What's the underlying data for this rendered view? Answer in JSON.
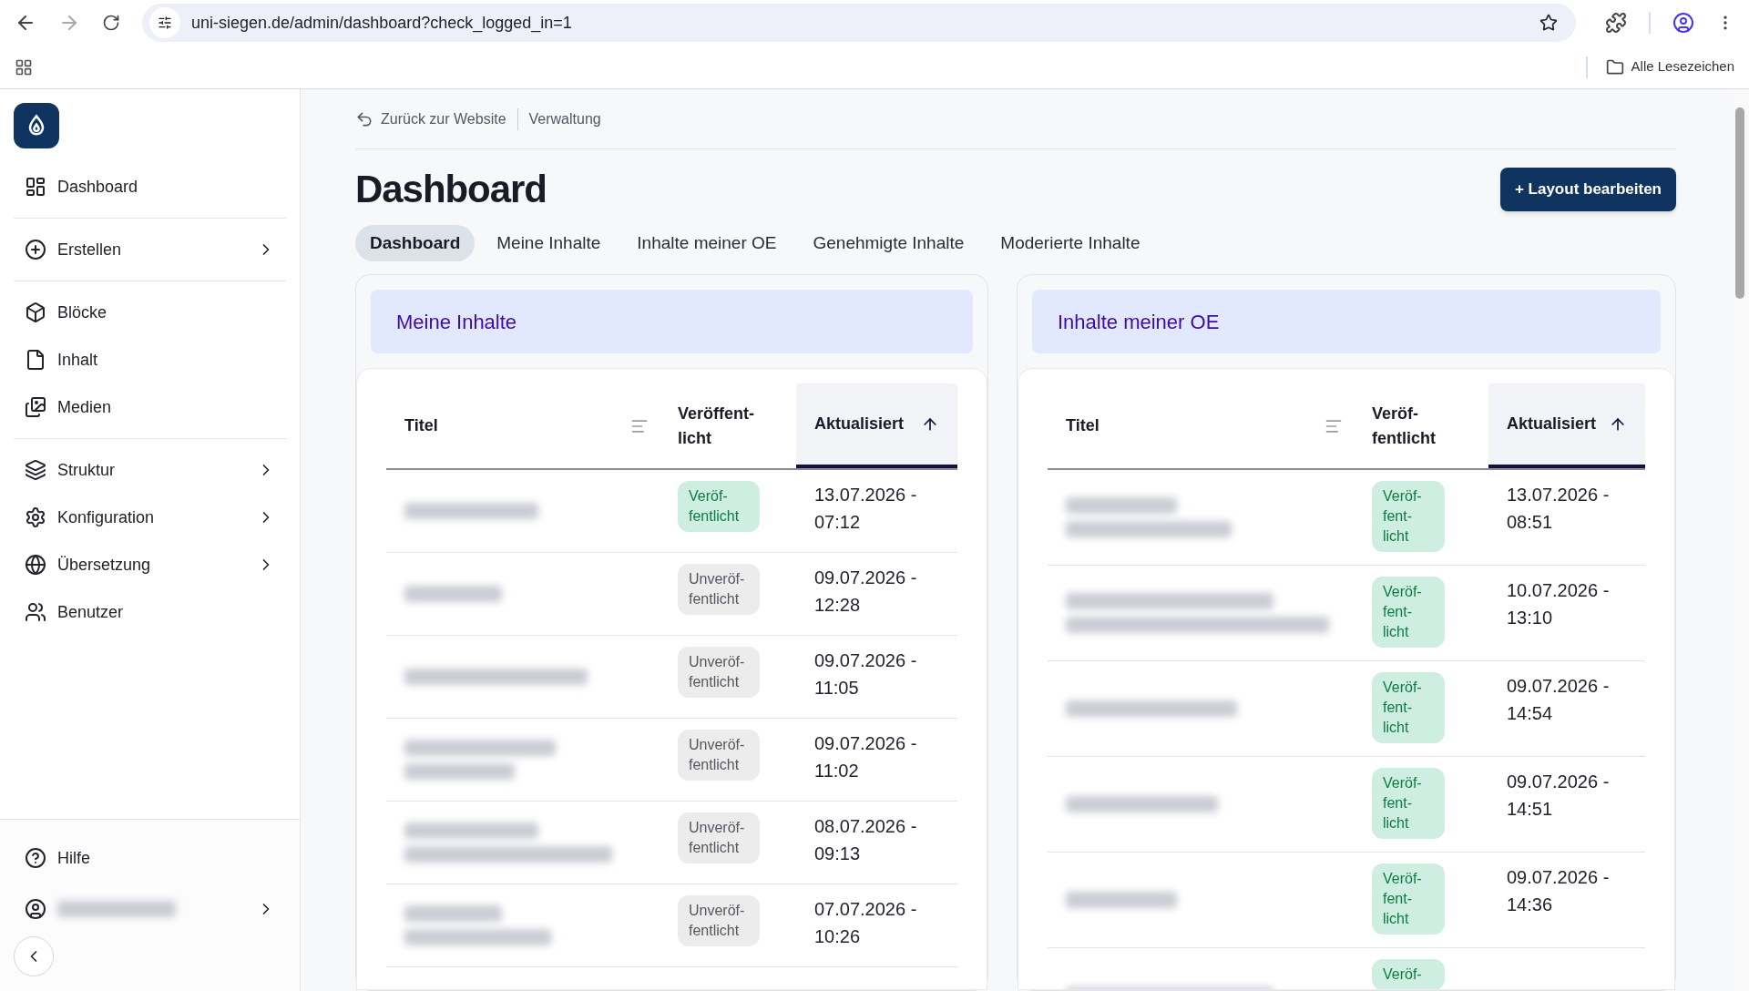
{
  "browser": {
    "url": "uni-siegen.de/admin/dashboard?check_logged_in=1",
    "bookmarks_label": "Alle Lesezeichen"
  },
  "sidebar": {
    "groups": [
      [
        {
          "label": "Dashboard",
          "has_submenu": false
        }
      ],
      [
        {
          "label": "Erstellen",
          "has_submenu": true
        }
      ],
      [
        {
          "label": "Blöcke",
          "has_submenu": false
        },
        {
          "label": "Inhalt",
          "has_submenu": false
        },
        {
          "label": "Medien",
          "has_submenu": false
        }
      ],
      [
        {
          "label": "Struktur",
          "has_submenu": true
        },
        {
          "label": "Konfiguration",
          "has_submenu": true
        },
        {
          "label": "Übersetzung",
          "has_submenu": true
        },
        {
          "label": "Benutzer",
          "has_submenu": false
        }
      ]
    ],
    "help": {
      "label": "Hilfe"
    },
    "user": {
      "kind": "redacted"
    }
  },
  "breadcrumb": [
    {
      "label": "Zurück zur Website",
      "kind": "back"
    },
    {
      "label": "Verwaltung",
      "kind": "plain"
    }
  ],
  "page_title": "Dashboard",
  "primary_button": "+ Layout bearbeiten",
  "tabs": [
    {
      "label": "Dashboard",
      "selected": true
    },
    {
      "label": "Meine Inhalte",
      "selected": false
    },
    {
      "label": "Inhalte meiner OE",
      "selected": false
    },
    {
      "label": "Genehmigte Inhalte",
      "selected": false
    },
    {
      "label": "Moderierte Inhalte",
      "selected": false
    }
  ],
  "panels": [
    {
      "title": "Meine Inhalte",
      "columns": [
        {
          "label": [
            "Titel"
          ],
          "sorted": false,
          "filter": true
        },
        {
          "label": [
            "Veröffent-",
            "licht"
          ],
          "sorted": false,
          "filter": false
        },
        {
          "label": [
            "Aktualisiert"
          ],
          "sorted": true,
          "filter": false
        }
      ],
      "rows": [
        {
          "kind": "redacted-single",
          "published": true,
          "status": [
            "Veröf-",
            "fentlicht"
          ],
          "updated": [
            "13.07.2026 -",
            "07:12"
          ]
        },
        {
          "kind": "redacted-single",
          "published": false,
          "status": [
            "Unveröf-",
            "fentlicht"
          ],
          "updated": [
            "09.07.2026 -",
            "12:28"
          ]
        },
        {
          "kind": "redacted-single",
          "published": false,
          "status": [
            "Unveröf-",
            "fentlicht"
          ],
          "updated": [
            "09.07.2026 -",
            "11:05"
          ]
        },
        {
          "kind": "redacted-double",
          "published": false,
          "status": [
            "Unveröf-",
            "fentlicht"
          ],
          "updated": [
            "09.07.2026 -",
            "11:02"
          ]
        },
        {
          "kind": "redacted-double",
          "published": false,
          "status": [
            "Unveröf-",
            "fentlicht"
          ],
          "updated": [
            "08.07.2026 -",
            "09:13"
          ]
        },
        {
          "kind": "redacted-double",
          "published": false,
          "status": [
            "Unveröf-",
            "fentlicht"
          ],
          "updated": [
            "07.07.2026 -",
            "10:26"
          ]
        }
      ]
    },
    {
      "title": "Inhalte meiner OE",
      "columns": [
        {
          "label": [
            "Titel"
          ],
          "sorted": false,
          "filter": true
        },
        {
          "label": [
            "Veröf-",
            "fentlicht"
          ],
          "sorted": false,
          "filter": false
        },
        {
          "label": [
            "Aktualisiert"
          ],
          "sorted": true,
          "filter": false
        }
      ],
      "rows": [
        {
          "kind": "redacted-double",
          "published": true,
          "status": [
            "Veröf-",
            "fent-",
            "licht"
          ],
          "updated": [
            "13.07.2026 -",
            "08:51"
          ]
        },
        {
          "kind": "redacted-double",
          "published": true,
          "status": [
            "Veröf-",
            "fent-",
            "licht"
          ],
          "updated": [
            "10.07.2026 -",
            "13:10"
          ]
        },
        {
          "kind": "redacted-single",
          "published": true,
          "status": [
            "Veröf-",
            "fent-",
            "licht"
          ],
          "updated": [
            "09.07.2026 -",
            "14:54"
          ]
        },
        {
          "kind": "redacted-single",
          "published": true,
          "status": [
            "Veröf-",
            "fent-",
            "licht"
          ],
          "updated": [
            "09.07.2026 -",
            "14:51"
          ]
        },
        {
          "kind": "redacted-single",
          "published": true,
          "status": [
            "Veröf-",
            "fent-",
            "licht"
          ],
          "updated": [
            "09.07.2026 -",
            "14:36"
          ]
        },
        {
          "kind": "redacted-single",
          "published": true,
          "status": [
            "Veröf-"
          ],
          "updated": []
        }
      ]
    }
  ]
}
